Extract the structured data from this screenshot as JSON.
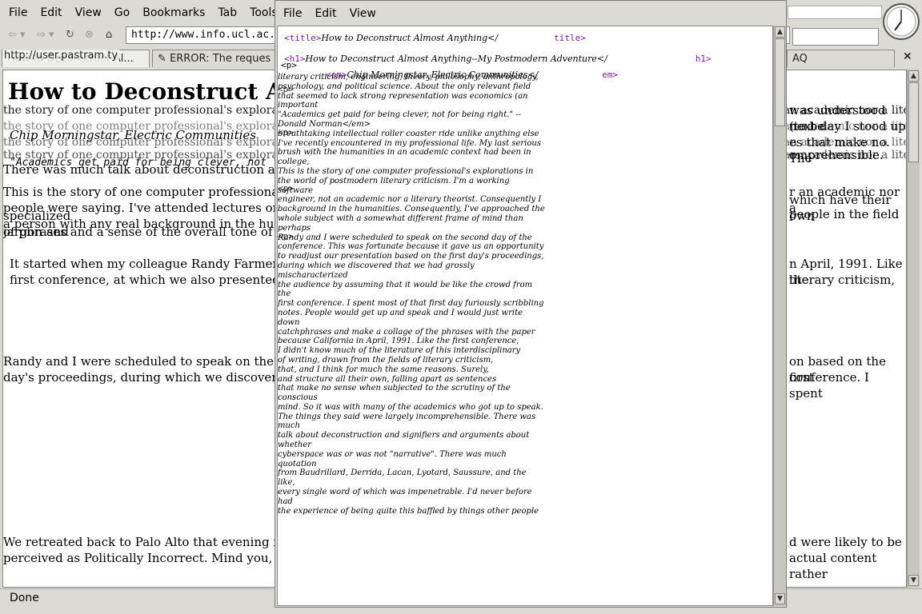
{
  "browser": {
    "menu": [
      "File",
      "Edit",
      "View",
      "Go",
      "Bookmarks",
      "Tab",
      "Tools"
    ],
    "url": "http://www.info.ucl.ac.be/p",
    "url_tooltip": "http://user.pastram.ty",
    "tabs": [
      {
        "label": "How to Deconstruct Al..."
      },
      {
        "label": "ERROR: The reques"
      },
      {
        "label": "AQ"
      }
    ],
    "close_label": "✕",
    "status": "Done",
    "page": {
      "title": "How to Deconstruct Alm",
      "byline": "Chip Morningstar, Electric Communities",
      "quote": "\"Academics get paid for being clever, not for being r",
      "p1_start": "the story of one computer professional's explorations in the world of postmodern literary criticism. I'm a working software engineer, not an academic nor a literary theorist. I was led into the humanities by being asked to write",
      "p_talk": "There was much talk about deconstruction and signifie",
      "p_story": "This is the story of one computer professional's explo",
      "p_people": "people were saying. I've attended lectures on quantum",
      "p_person": "a person with any real background in the humanities. C",
      "p_jargon": "specialized jargon and",
      "p_phrases": "of phrases and a sense of the overall tone of the event",
      "p_started1": "It started when my colleague Randy Farmer and I pre",
      "p_started2": "first conference, at which we also presented a paper,",
      "p_randy1": "Randy and I were scheduled to speak on the second da",
      "p_randy2": "day's proceedings, during which we discovered that w",
      "p_retreat1": "We retreated back to Palo Alto that evening for a quick",
      "p_retreat2": "perceived as Politically Incorrect. Mind you, the funda",
      "right_1": "was understood (to be",
      "right_2": "next day I stood up",
      "right_3": "es that make no. The",
      "right_4": "omprehensible.",
      "right_5": "r an academic nor a",
      "right_6": "which have their own",
      "right_7": "people in the field",
      "right_8": "n April, 1991. Like the",
      "right_9": "literary criticism,",
      "right_10": "on based on the first",
      "right_11": "conference. I spent",
      "right_12": "d were likely to be",
      "right_13": "actual content rather"
    }
  },
  "source": {
    "menu": [
      "File",
      "Edit",
      "View"
    ],
    "title_open": "<title>",
    "title_text": "How to Deconstruct Almost Anything</",
    "title_close": "title>",
    "h1_open": "<h1>",
    "h1_text": "How to Deconstruct Almost Anything--My Postmodern Adventure</",
    "h1_close": "h1>",
    "em_tag": "em>",
    "em_open": "<em>",
    "byline_src": "Chip Morningstar, Electric Communities</",
    "p_tag": "<p>",
    "text_lines": [
      "literary criticism, engineering, theory, philosophy, anthropology,",
      "psychology, and political science. About the only relevant field",
      "that seemed to lack strong representation was economics (an important",
      "\"Academics get paid for being clever, not for being right.\" --",
      "Donald Norman</em>",
      "breathtaking intellectual roller coaster ride unlike anything else",
      "I've recently encountered in my professional life. My last serious",
      "brush with the humanities in an academic context had been in college,",
      "This is the story of one computer professional's explorations in",
      "the world of postmodern literary criticism. I'm a working software",
      "engineer, not an academic nor a literary theorist. Consequently I",
      "background in the humanities. Consequently, I've approached the",
      "whole subject with a somewhat different frame of mind than perhaps",
      "Randy and I were scheduled to speak on the second day of the",
      "conference. This was fortunate because it gave us an opportunity",
      "to readjust our presentation based on the first day's proceedings,",
      "during which we discovered that we had grossly mischaracterized",
      "the audience by assuming that it would be like the crowd from the",
      "first conference. I spent most of that first day furiously scribbling",
      "notes. People would get up and speak and I would just write down",
      "catchphrases and make a collage of the phrases with the paper",
      "because California in April, 1991. Like the first conference,",
      "I didn't know much of the literature of this interdisciplinary",
      "of writing, drawn from the fields of literary criticism, ",
      "that, and I think for much the same reasons. Surely,",
      "and structure all their own, falling apart as sentences",
      "that make no sense when subjected to the scrutiny of the conscious",
      "mind. So it was with many of the academics who got up to speak.",
      "The things they said were largely incomprehensible. There was much",
      "talk about deconstruction and signifiers and arguments about whether",
      "cyberspace was or was not \"narrative\". There was much quotation",
      "from Baudrillard, Derrida, Lacan, Lyotard, Saussure, and the like,",
      "every single word of which was impenetrable. I'd never before had",
      "the experience of being quite this baffled by things other people"
    ]
  },
  "colors": {
    "chrome": "#dcdad5",
    "tag_purple": "#7a1fa0"
  }
}
